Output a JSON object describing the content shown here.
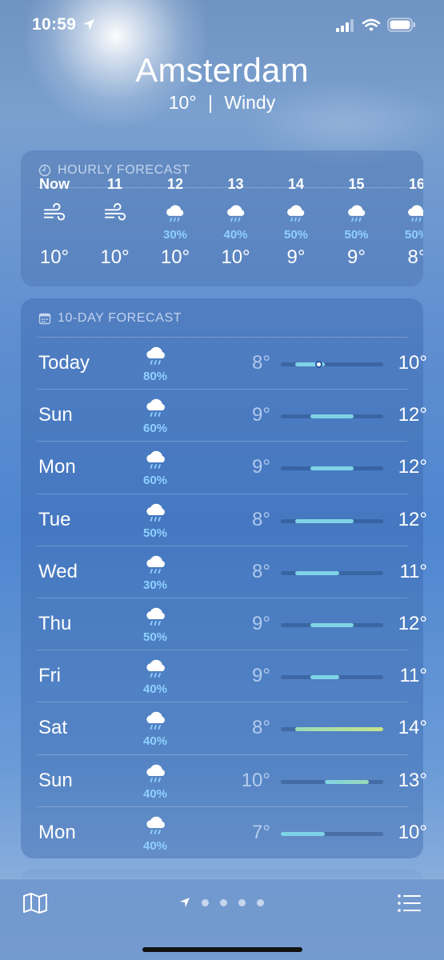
{
  "status_bar": {
    "time": "10:59"
  },
  "header": {
    "city": "Amsterdam",
    "temperature": "10°",
    "separator": "|",
    "condition": "Windy"
  },
  "hourly": {
    "title": "HOURLY FORECAST",
    "hours": [
      {
        "time": "Now",
        "icon": "wind-icon",
        "precip": "",
        "temp": "10°"
      },
      {
        "time": "11",
        "icon": "wind-icon",
        "precip": "",
        "temp": "10°"
      },
      {
        "time": "12",
        "icon": "rain-cloud-icon",
        "precip": "30%",
        "temp": "10°"
      },
      {
        "time": "13",
        "icon": "rain-cloud-icon",
        "precip": "40%",
        "temp": "10°"
      },
      {
        "time": "14",
        "icon": "rain-cloud-icon",
        "precip": "50%",
        "temp": "9°"
      },
      {
        "time": "15",
        "icon": "rain-cloud-icon",
        "precip": "50%",
        "temp": "9°"
      },
      {
        "time": "16",
        "icon": "rain-cloud-icon",
        "precip": "50%",
        "temp": "8°"
      }
    ]
  },
  "daily": {
    "title": "10-DAY FORECAST",
    "days": [
      {
        "day": "Today",
        "icon": "rain-cloud-icon",
        "precip": "80%",
        "low": "8°",
        "high": "10°",
        "low_value": 8,
        "high_value": 10,
        "current_value": 9.6
      },
      {
        "day": "Sun",
        "icon": "rain-cloud-icon",
        "precip": "60%",
        "low": "9°",
        "high": "12°",
        "low_value": 9,
        "high_value": 12
      },
      {
        "day": "Mon",
        "icon": "rain-cloud-icon",
        "precip": "60%",
        "low": "9°",
        "high": "12°",
        "low_value": 9,
        "high_value": 12
      },
      {
        "day": "Tue",
        "icon": "rain-cloud-icon",
        "precip": "50%",
        "low": "8°",
        "high": "12°",
        "low_value": 8,
        "high_value": 12
      },
      {
        "day": "Wed",
        "icon": "rain-cloud-icon",
        "precip": "30%",
        "low": "8°",
        "high": "11°",
        "low_value": 8,
        "high_value": 11
      },
      {
        "day": "Thu",
        "icon": "rain-cloud-icon",
        "precip": "50%",
        "low": "9°",
        "high": "12°",
        "low_value": 9,
        "high_value": 12
      },
      {
        "day": "Fri",
        "icon": "rain-cloud-icon",
        "precip": "40%",
        "low": "9°",
        "high": "11°",
        "low_value": 9,
        "high_value": 11
      },
      {
        "day": "Sat",
        "icon": "rain-cloud-icon",
        "precip": "40%",
        "low": "8°",
        "high": "14°",
        "low_value": 8,
        "high_value": 14
      },
      {
        "day": "Sun",
        "icon": "rain-cloud-icon",
        "precip": "40%",
        "low": "10°",
        "high": "13°",
        "low_value": 10,
        "high_value": 13
      },
      {
        "day": "Mon",
        "icon": "rain-cloud-icon",
        "precip": "40%",
        "low": "7°",
        "high": "10°",
        "low_value": 7,
        "high_value": 10
      }
    ],
    "range_min": 7,
    "range_max": 14
  },
  "bottom_bar": {
    "page_count": 4,
    "active_page": "location-arrow-icon"
  },
  "colors": {
    "precip_blue": "#8fd0ff",
    "bar_cool": "#7fd3e6",
    "bar_mild": "#9adbb8",
    "bar_warm": "#c6e28a"
  }
}
